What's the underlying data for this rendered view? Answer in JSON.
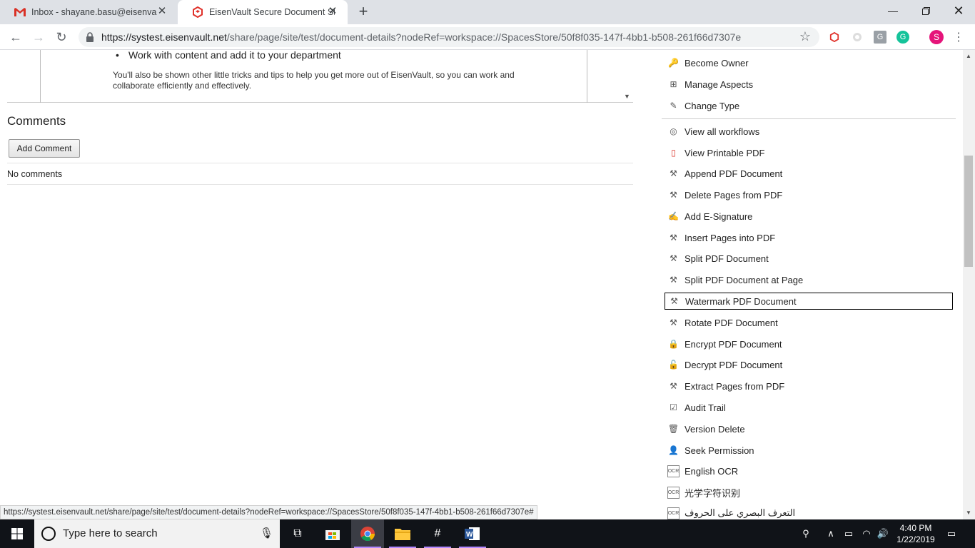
{
  "browser": {
    "tabs": [
      {
        "title": "Inbox - shayane.basu@eisenvault",
        "favicon": "gmail-icon"
      },
      {
        "title": "EisenVault Secure Document Stor",
        "favicon": "eisenvault-icon"
      }
    ],
    "url_host": "https://systest.eisenvault.net",
    "url_path": "/share/page/site/test/document-details?nodeRef=workspace://SpacesStore/50f8f035-147f-4bb1-b508-261f66d7307e",
    "profile_initial": "S",
    "status_url": "https://systest.eisenvault.net/share/page/site/test/document-details?nodeRef=workspace://SpacesStore/50f8f035-147f-4bb1-b508-261f66d7307e#"
  },
  "preview": {
    "bullet": "Work with content and add it to your department",
    "paragraph": "You'll also be shown other little tricks and tips to help you get more out of EisenVault, so you can work and collaborate efficiently and effectively."
  },
  "comments": {
    "title": "Comments",
    "add_label": "Add Comment",
    "empty_text": "No comments"
  },
  "actions": [
    {
      "label": "Become Owner",
      "icon": "key-icon"
    },
    {
      "label": "Manage Aspects",
      "icon": "aspects-icon"
    },
    {
      "label": "Change Type",
      "icon": "pencil-icon"
    },
    {
      "label": "View all workflows",
      "icon": "workflow-icon"
    },
    {
      "label": "View Printable PDF",
      "icon": "pdf-icon"
    },
    {
      "label": "Append PDF Document",
      "icon": "pdf-tool-icon"
    },
    {
      "label": "Delete Pages from PDF",
      "icon": "pdf-tool-icon"
    },
    {
      "label": "Add E-Signature",
      "icon": "signature-icon"
    },
    {
      "label": "Insert Pages into PDF",
      "icon": "pdf-tool-icon"
    },
    {
      "label": "Split PDF Document",
      "icon": "pdf-tool-icon"
    },
    {
      "label": "Split PDF Document at Page",
      "icon": "pdf-tool-icon"
    },
    {
      "label": "Watermark PDF Document",
      "icon": "pdf-tool-icon"
    },
    {
      "label": "Rotate PDF Document",
      "icon": "pdf-tool-icon"
    },
    {
      "label": "Encrypt PDF Document",
      "icon": "lock-pdf-icon"
    },
    {
      "label": "Decrypt PDF Document",
      "icon": "unlock-pdf-icon"
    },
    {
      "label": "Extract Pages from PDF",
      "icon": "pdf-tool-icon"
    },
    {
      "label": "Audit Trail",
      "icon": "checkbox-icon"
    },
    {
      "label": "Version Delete",
      "icon": "trash-icon"
    },
    {
      "label": "Seek Permission",
      "icon": "permission-icon"
    },
    {
      "label": "English OCR",
      "icon": "ocr-icon"
    },
    {
      "label": "光学字符识别",
      "icon": "ocr-icon"
    },
    {
      "label": "التعرف البصري على الحروف",
      "icon": "ocr-icon"
    }
  ],
  "focused_action": "Watermark PDF Document",
  "taskbar": {
    "search_placeholder": "Type here to search",
    "time": "4:40 PM",
    "date": "1/22/2019"
  },
  "colors": {
    "accent_profile": "#e5147a",
    "taskbar_bg": "#101318",
    "tab_bg": "#dee1e6"
  }
}
